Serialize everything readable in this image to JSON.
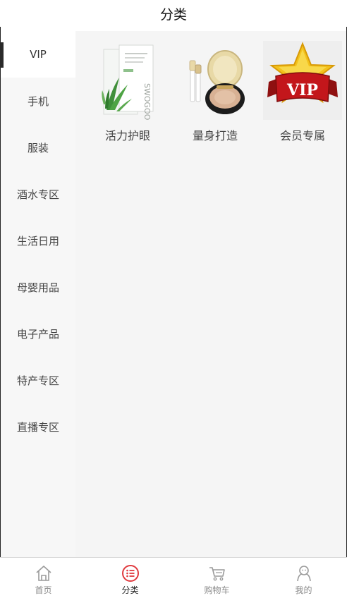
{
  "header": {
    "title": "分类"
  },
  "sidebar": {
    "items": [
      {
        "label": "VIP",
        "active": true
      },
      {
        "label": "手机"
      },
      {
        "label": "服装"
      },
      {
        "label": "酒水专区"
      },
      {
        "label": "生活日用"
      },
      {
        "label": "母婴用品"
      },
      {
        "label": "电子产品"
      },
      {
        "label": "特产专区"
      },
      {
        "label": "直播专区"
      }
    ]
  },
  "products": [
    {
      "label": "活力护眼",
      "image": "eye-mask-pack-image",
      "pack_text": "SWOGOO"
    },
    {
      "label": "量身打造",
      "image": "cushion-compact-image"
    },
    {
      "label": "会员专属",
      "image": "vip-star-badge-image",
      "badge_text": "VIP"
    }
  ],
  "tabbar": {
    "tabs": [
      {
        "label": "首页",
        "icon": "home-icon"
      },
      {
        "label": "分类",
        "icon": "category-icon",
        "active": true
      },
      {
        "label": "购物车",
        "icon": "cart-icon"
      },
      {
        "label": "我的",
        "icon": "profile-icon"
      }
    ]
  },
  "colors": {
    "accent": "#e0393e",
    "active_indicator": "#2a2a2a",
    "sidebar_bg": "#f7f7f7",
    "content_bg": "#f5f5f5"
  }
}
